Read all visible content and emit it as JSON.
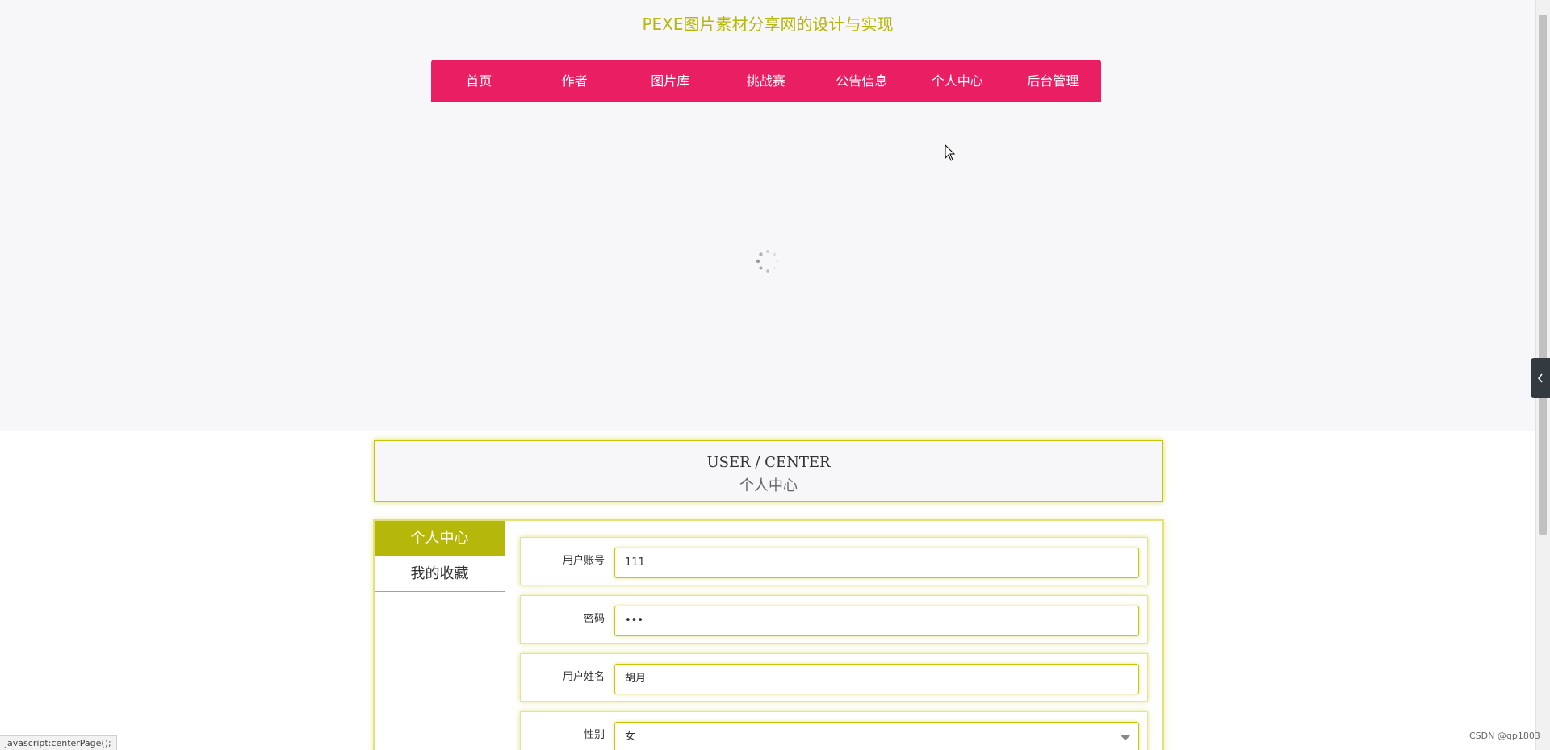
{
  "site": {
    "title": "PEXE图片素材分享网的设计与实现"
  },
  "nav": {
    "items": [
      {
        "label": "首页"
      },
      {
        "label": "作者"
      },
      {
        "label": "图片库"
      },
      {
        "label": "挑战赛"
      },
      {
        "label": "公告信息"
      },
      {
        "label": "个人中心"
      },
      {
        "label": "后台管理"
      }
    ]
  },
  "center_header": {
    "en": "USER / CENTER",
    "cn": "个人中心"
  },
  "side_menu": {
    "items": [
      {
        "label": "个人中心",
        "active": true
      },
      {
        "label": "我的收藏",
        "active": false
      }
    ]
  },
  "form": {
    "username": {
      "label": "用户账号",
      "value": "111"
    },
    "password": {
      "label": "密码",
      "value": "•••"
    },
    "name": {
      "label": "用户姓名",
      "value": "胡月"
    },
    "gender": {
      "label": "性别",
      "value": "女"
    }
  },
  "status_bar": {
    "text": "javascript:centerPage();"
  },
  "watermark": {
    "text": "CSDN @gp1803"
  },
  "colors": {
    "accent": "#b5b80a",
    "nav_bg": "#e91e63",
    "border_glow": "#c5c800"
  },
  "icons": {
    "cursor": "mouse-pointer-icon",
    "spinner": "loading-spinner-icon",
    "side_toggle": "chevron-left-icon",
    "select_arrow": "chevron-down-icon"
  }
}
